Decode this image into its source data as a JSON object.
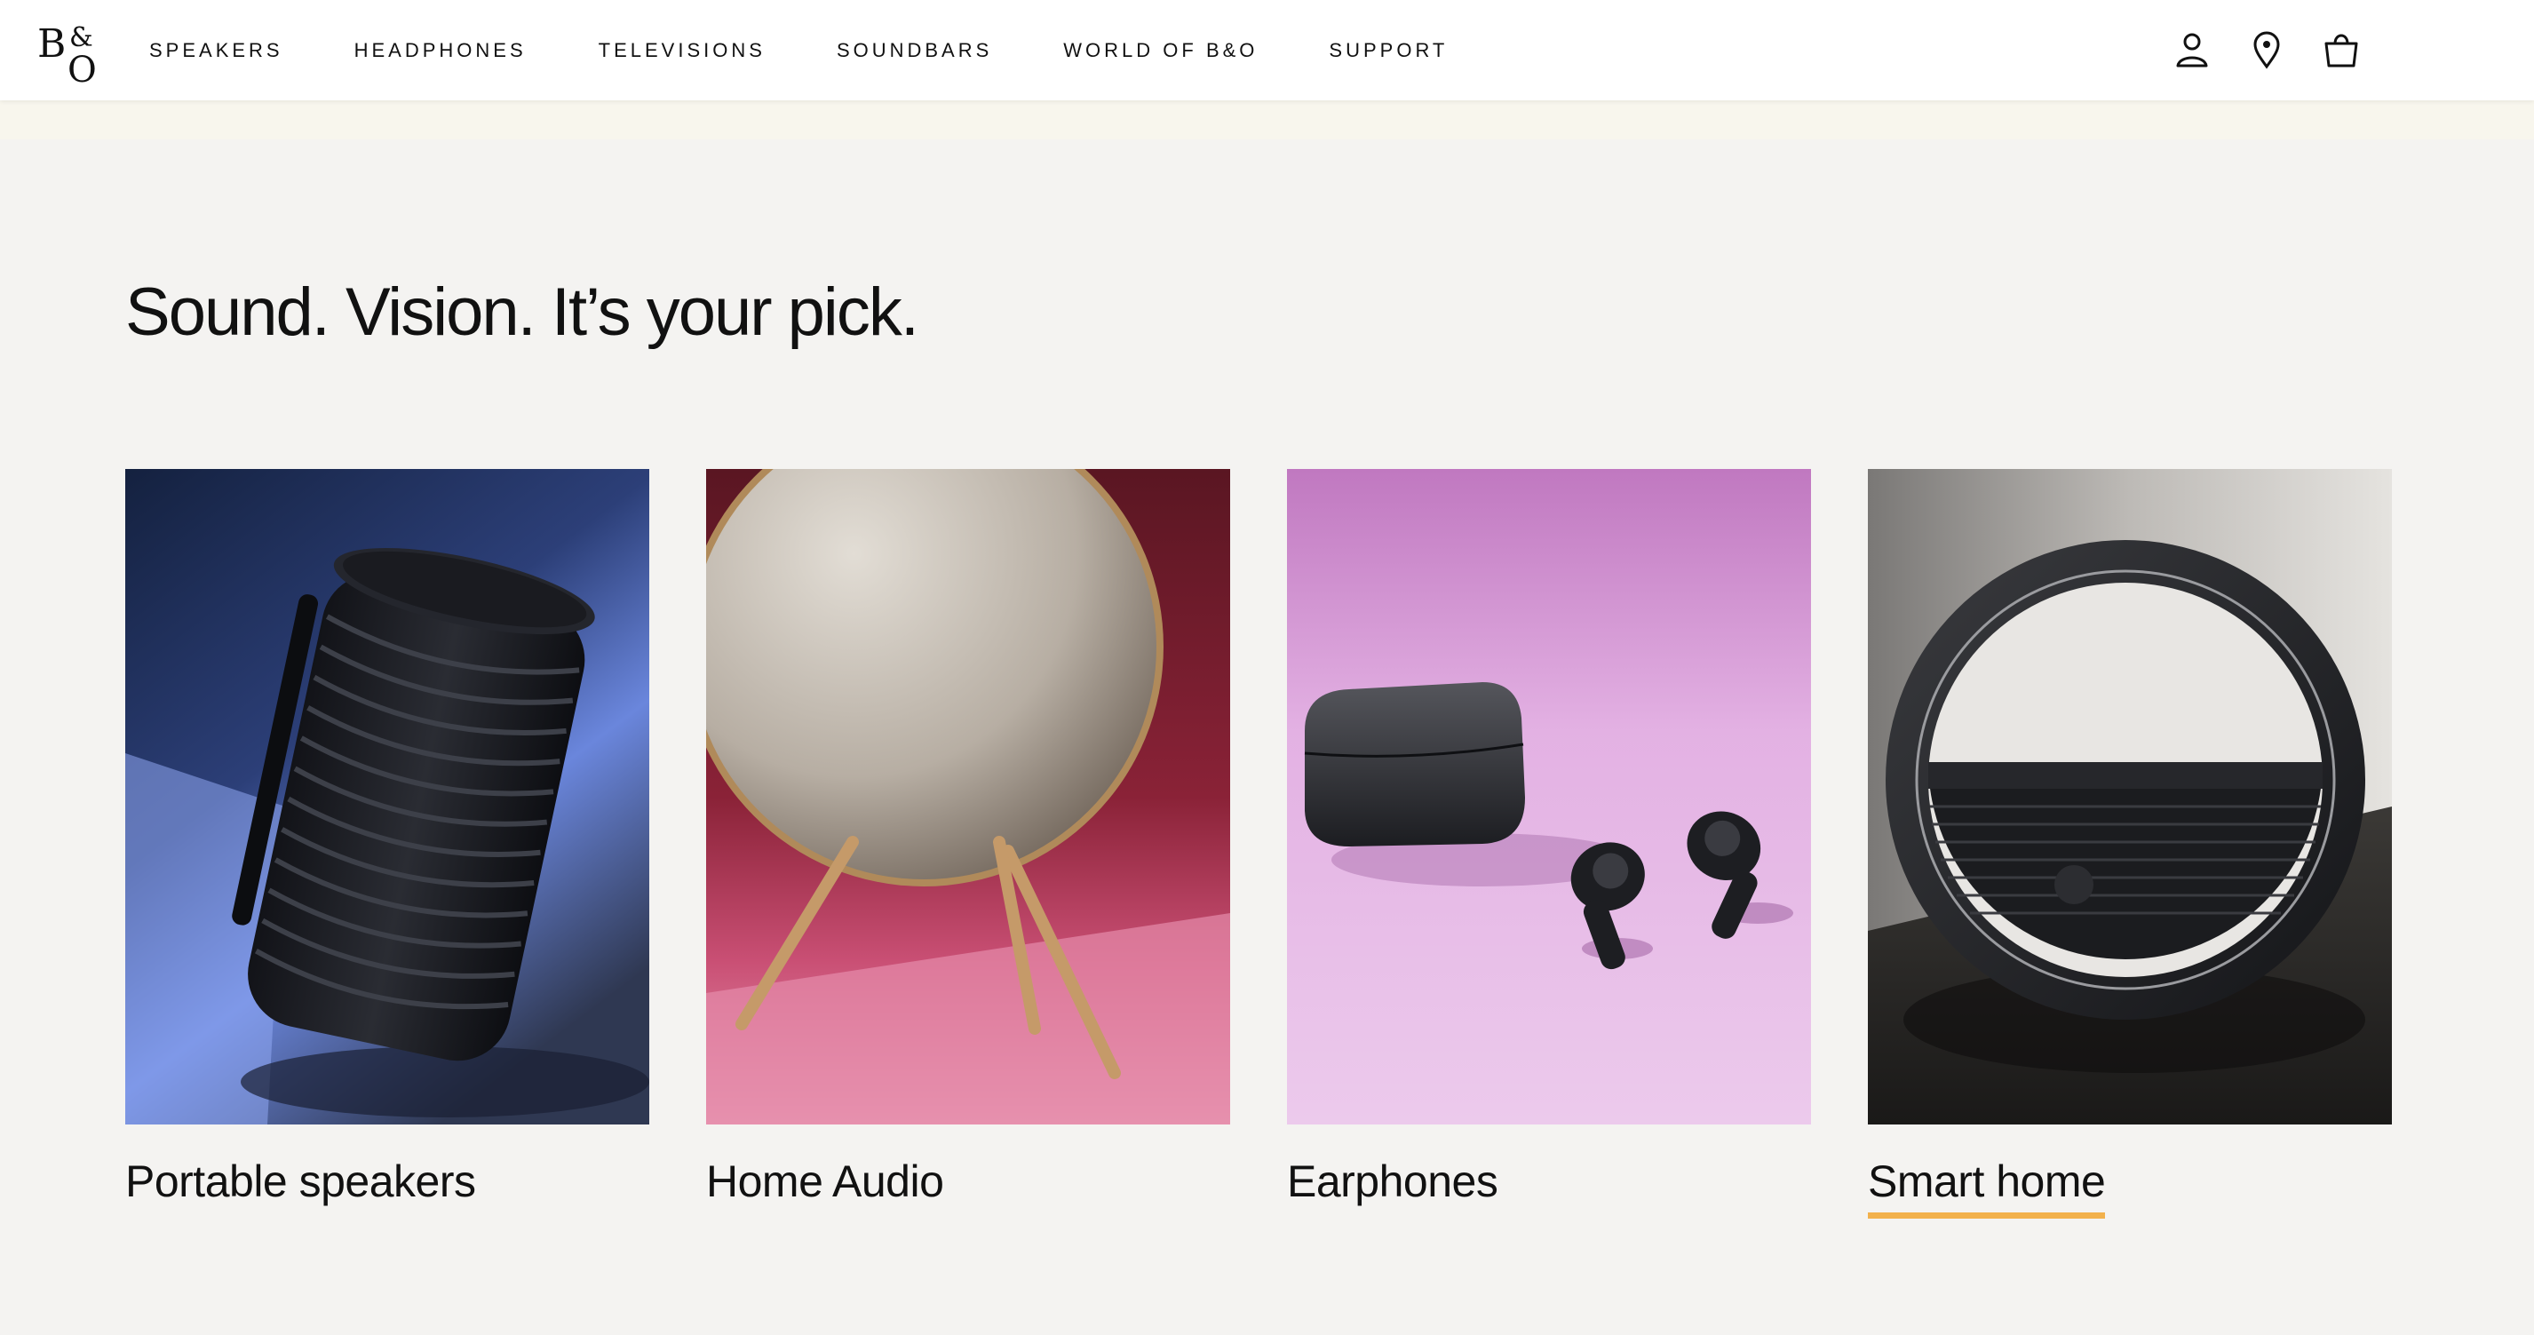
{
  "header": {
    "logo_text": "B&O",
    "nav": [
      {
        "label": "SPEAKERS"
      },
      {
        "label": "HEADPHONES"
      },
      {
        "label": "TELEVISIONS"
      },
      {
        "label": "SOUNDBARS"
      },
      {
        "label": "WORLD OF B&O"
      },
      {
        "label": "SUPPORT"
      }
    ],
    "icons": [
      "user-icon",
      "location-pin-icon",
      "shopping-bag-icon"
    ]
  },
  "main": {
    "headline": "Sound. Vision. It’s your pick.",
    "categories": [
      {
        "label": "Portable speakers",
        "image": "portable-speaker-image",
        "active": false
      },
      {
        "label": "Home Audio",
        "image": "home-audio-speaker-image",
        "active": false
      },
      {
        "label": "Earphones",
        "image": "earphones-image",
        "active": false
      },
      {
        "label": "Smart home",
        "image": "smart-home-image",
        "active": true
      }
    ]
  },
  "colors": {
    "page_background": "#f4f3f1",
    "header_background": "#ffffff",
    "banner_background": "#f8f6ed",
    "active_underline": "#f2b14c",
    "text": "#111111"
  }
}
